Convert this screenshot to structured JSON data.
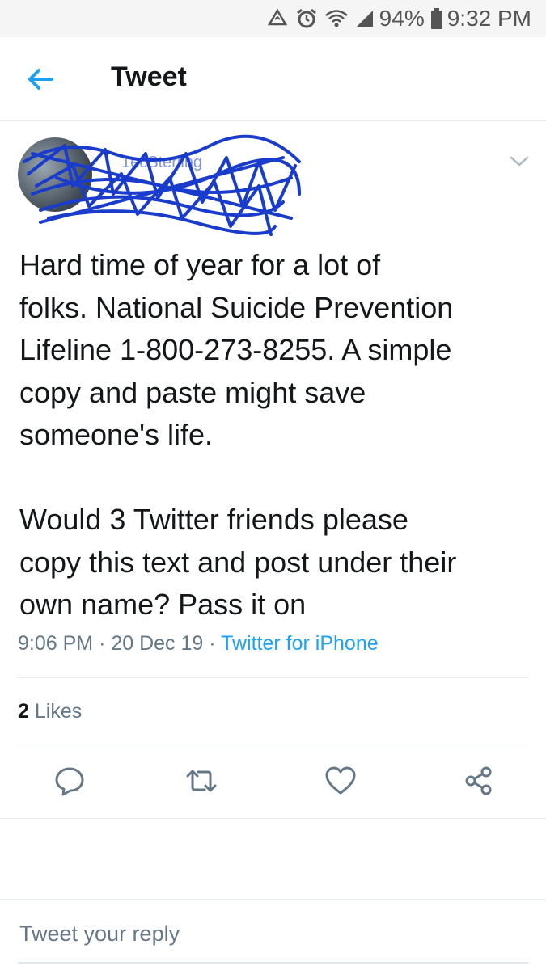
{
  "status_bar": {
    "battery": "94%",
    "time": "9:32 PM"
  },
  "header": {
    "title": "Tweet"
  },
  "tweet": {
    "author_handle_partial": "1ecSterling",
    "text": "Hard time of year for a lot of\nfolks. National Suicide Prevention\nLifeline 1-800-273-8255. A simple\ncopy and paste might save\nsomeone's life.\n\nWould 3 Twitter friends please\ncopy this text and post under their\nown name? Pass it on",
    "time": "9:06 PM",
    "separator": "·",
    "date": "20 Dec 19",
    "source": "Twitter for iPhone",
    "likes_count": "2",
    "likes_label": "Likes"
  },
  "reply": {
    "placeholder": "Tweet your reply"
  },
  "colors": {
    "accent": "#1da1f2",
    "text": "#14171a",
    "secondary": "#657786",
    "scribble": "#1a3ccc"
  }
}
